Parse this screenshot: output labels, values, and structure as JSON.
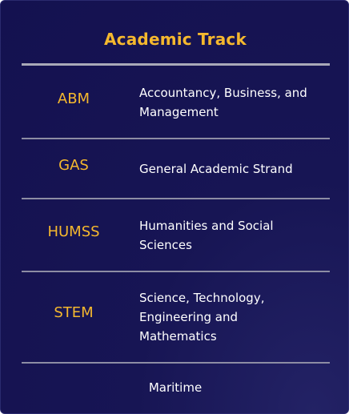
{
  "table": {
    "title": "Academic Track",
    "rows": [
      {
        "code": "ABM",
        "description": "Accountancy, Business, and Management"
      },
      {
        "code": "GAS",
        "description": "General Academic Strand"
      },
      {
        "code": "HUMSS",
        "description": "Humanities and Social Sciences"
      },
      {
        "code": "STEM",
        "description": "Science, Technology, Engineering and Mathematics"
      },
      {
        "code": "",
        "description": "Maritime"
      }
    ]
  },
  "colors": {
    "background": "#141150",
    "accent": "#f5b82e",
    "text": "#ffffff",
    "divider": "#8d8da4"
  }
}
